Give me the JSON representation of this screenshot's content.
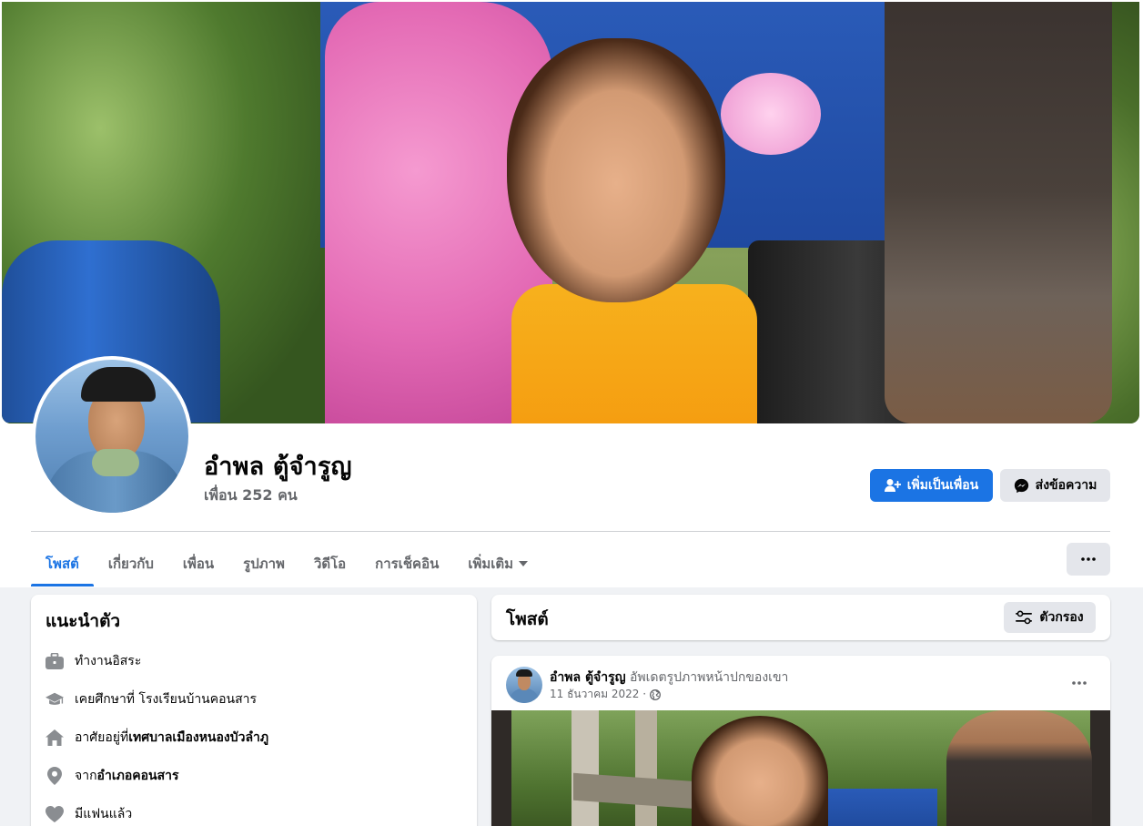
{
  "profile": {
    "name": "อำพล ตู้จำรูญ",
    "friends": "เพื่อน 252 คน"
  },
  "actions": {
    "add_friend": "เพิ่มเป็นเพื่อน",
    "message": "ส่งข้อความ"
  },
  "tabs": [
    {
      "label": "โพสต์",
      "active": true
    },
    {
      "label": "เกี่ยวกับ"
    },
    {
      "label": "เพื่อน"
    },
    {
      "label": "รูปภาพ"
    },
    {
      "label": "วิดีโอ"
    },
    {
      "label": "การเช็คอิน"
    },
    {
      "label": "เพิ่มเติม"
    }
  ],
  "intro": {
    "title": "แนะนำตัว",
    "items": [
      {
        "icon": "briefcase-icon",
        "prefix": "ทำงานอิสระ",
        "bold": ""
      },
      {
        "icon": "graduation-cap-icon",
        "prefix": "เคยศึกษาที่ โรงเรียนบ้านคอนสาร",
        "bold": ""
      },
      {
        "icon": "home-icon",
        "prefix": "อาศัยอยู่ที่ ",
        "bold": "เทศบาลเมืองหนองบัวลำภู"
      },
      {
        "icon": "location-pin-icon",
        "prefix": "จาก ",
        "bold": "อำเภอคอนสาร"
      },
      {
        "icon": "heart-icon",
        "prefix": "มีแฟนแล้ว",
        "bold": ""
      }
    ]
  },
  "posts_section": {
    "title": "โพสต์",
    "filter_label": "ตัวกรอง"
  },
  "post": {
    "author": "อำพล ตู้จำรูญ",
    "action": " อัพเดตรูปภาพหน้าปกของเขา",
    "date": "11 ธันวาคม 2022 ·",
    "privacy_icon": "globe-icon"
  },
  "colors": {
    "accent": "#1b74e4",
    "background": "#f0f2f5",
    "secondary_text": "#65676b"
  }
}
